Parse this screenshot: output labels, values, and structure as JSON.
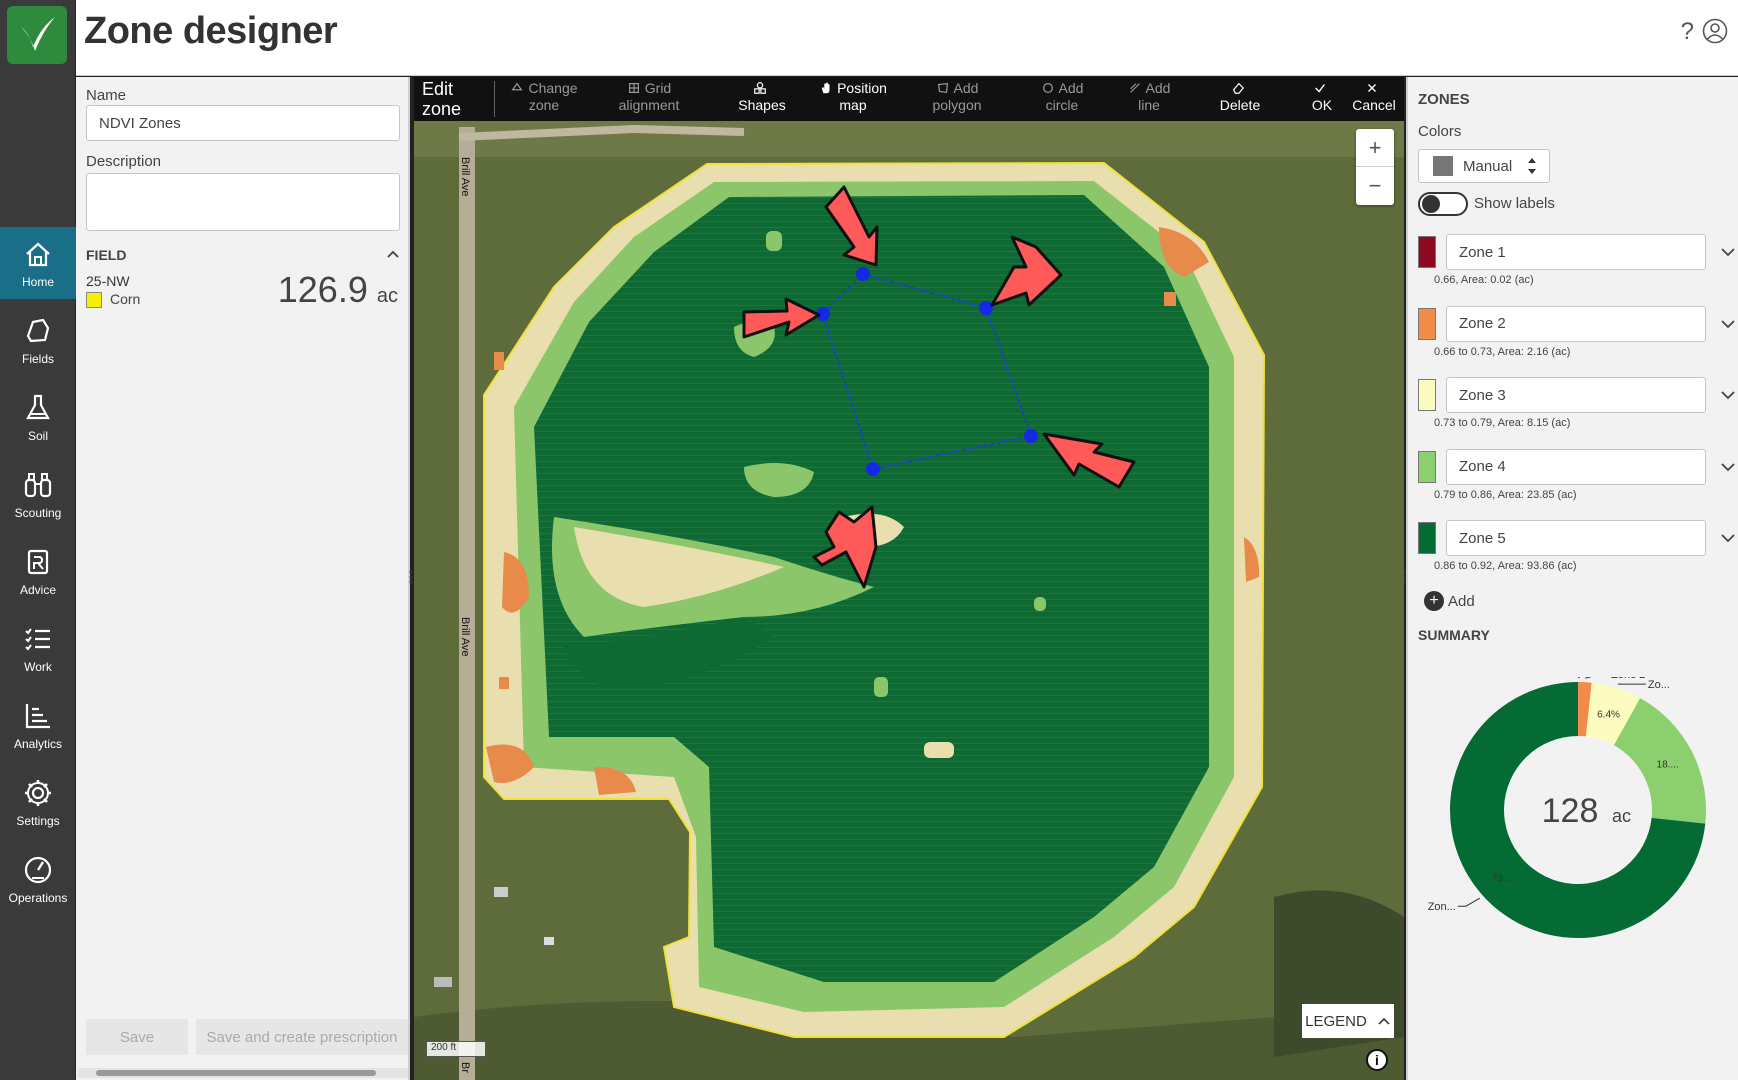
{
  "app": {
    "title": "Zone designer"
  },
  "nav": [
    {
      "label": "Home",
      "icon": "home-icon",
      "active": true
    },
    {
      "label": "Fields",
      "icon": "fields-icon"
    },
    {
      "label": "Soil",
      "icon": "flask-icon"
    },
    {
      "label": "Scouting",
      "icon": "binoculars-icon"
    },
    {
      "label": "Advice",
      "icon": "prescription-icon"
    },
    {
      "label": "Work",
      "icon": "checklist-icon"
    },
    {
      "label": "Analytics",
      "icon": "chart-icon"
    },
    {
      "label": "Settings",
      "icon": "gear-icon"
    },
    {
      "label": "Operations",
      "icon": "gauge-icon"
    }
  ],
  "form": {
    "name_label": "Name",
    "name_value": "NDVI Zones",
    "description_label": "Description",
    "description_value": "",
    "field_header": "FIELD",
    "field_name": "25-NW",
    "crop": "Corn",
    "crop_color": "#f5f000",
    "acres_value": "126.9",
    "acres_unit": "ac",
    "save_label": "Save",
    "save_create_label": "Save and create prescription"
  },
  "toolbar": {
    "edit_line1": "Edit",
    "edit_line2": "zone",
    "items": [
      {
        "l1": "Change",
        "l2": "zone",
        "icon": "change-zone-icon",
        "enabled": false
      },
      {
        "l1": "Grid",
        "l2": "alignment",
        "icon": "grid-icon",
        "enabled": false
      },
      {
        "l1": "",
        "l2": "Shapes",
        "icon": "shapes-icon",
        "enabled": true
      },
      {
        "l1": "Position",
        "l2": "map",
        "icon": "hand-icon",
        "enabled": true
      },
      {
        "l1": "Add",
        "l2": "polygon",
        "icon": "polygon-icon",
        "enabled": false
      },
      {
        "l1": "Add",
        "l2": "circle",
        "icon": "circle-icon",
        "enabled": false
      },
      {
        "l1": "Add",
        "l2": "line",
        "icon": "line-icon",
        "enabled": false
      },
      {
        "l1": "",
        "l2": "Delete",
        "icon": "eraser-icon",
        "enabled": true
      },
      {
        "l1": "",
        "l2": "OK",
        "icon": "check-icon",
        "enabled": true
      },
      {
        "l1": "",
        "l2": "Cancel",
        "icon": "close-icon",
        "enabled": true
      }
    ]
  },
  "map": {
    "zoom_in": "+",
    "zoom_out": "−",
    "legend_label": "LEGEND",
    "scale_label": "200 ft",
    "road_label_top": "Brill Ave",
    "road_label_mid": "Brill Ave",
    "road_label_bottom": "Br",
    "info_label": "i"
  },
  "zones_panel": {
    "header": "ZONES",
    "colors_label": "Colors",
    "color_mode": "Manual",
    "show_labels": "Show labels",
    "add_label": "Add",
    "summary_label": "SUMMARY",
    "zones": [
      {
        "name": "Zone 1",
        "color": "#8b0a22",
        "meta": "0.66, Area: 0.02 (ac)"
      },
      {
        "name": "Zone 2",
        "color": "#f28a4a",
        "meta": "0.66 to 0.73, Area: 2.16 (ac)"
      },
      {
        "name": "Zone 3",
        "color": "#fcfcc0",
        "meta": "0.73 to 0.79, Area: 8.15 (ac)"
      },
      {
        "name": "Zone 4",
        "color": "#8ccf6e",
        "meta": "0.79 to 0.86, Area: 23.85 (ac)"
      },
      {
        "name": "Zone 5",
        "color": "#056b35",
        "meta": "0.86 to 0.92, Area: 93.86 (ac)"
      }
    ]
  },
  "chart_data": {
    "type": "pie",
    "center_value": "128",
    "center_unit": "ac",
    "categories": [
      "Zone 1",
      "Zone 2",
      "Zone 3",
      "Zone 4",
      "Zone 5"
    ],
    "values": [
      0.02,
      2.16,
      8.15,
      23.85,
      93.86
    ],
    "colors": [
      "#8b0a22",
      "#f28a4a",
      "#fcfcc0",
      "#8ccf6e",
      "#056b35"
    ],
    "slice_labels": [
      "0.0%",
      "",
      "6.4%",
      "18....",
      "73...."
    ],
    "callouts": [
      "Zone 1",
      "Zone 2",
      "Zo...",
      "",
      "Zon..."
    ]
  }
}
